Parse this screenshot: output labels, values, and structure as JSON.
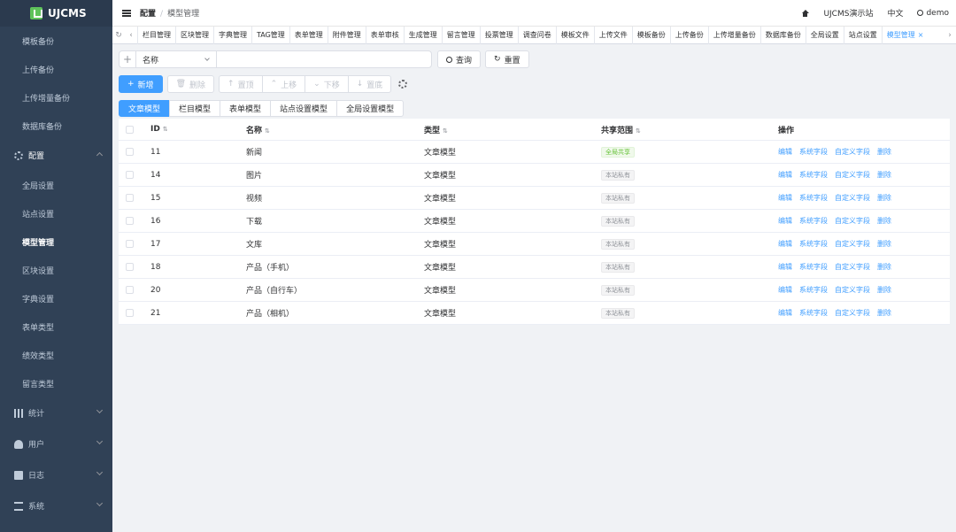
{
  "app": {
    "name": "UJCMS"
  },
  "sidebar": {
    "items_top": [
      {
        "label": "模板备份"
      },
      {
        "label": "上传备份"
      },
      {
        "label": "上传增量备份"
      },
      {
        "label": "数据库备份"
      }
    ],
    "config_group": {
      "label": "配置",
      "icon": "gear-icon"
    },
    "config_items": [
      {
        "label": "全局设置"
      },
      {
        "label": "站点设置"
      },
      {
        "label": "模型管理",
        "active": true
      },
      {
        "label": "区块设置"
      },
      {
        "label": "字典设置"
      },
      {
        "label": "表单类型"
      },
      {
        "label": "绩效类型"
      },
      {
        "label": "留言类型"
      }
    ],
    "groups": [
      {
        "label": "统计",
        "icon": "bar-chart-icon"
      },
      {
        "label": "用户",
        "icon": "user-icon"
      },
      {
        "label": "日志",
        "icon": "document-icon"
      },
      {
        "label": "系统",
        "icon": "sliders-icon"
      }
    ]
  },
  "header": {
    "breadcrumb_parent": "配置",
    "breadcrumb_sep": "/",
    "breadcrumb_current": "模型管理",
    "site": "UJCMS演示站",
    "lang": "中文",
    "user": "demo"
  },
  "tabs": [
    "栏目管理",
    "区块管理",
    "字典管理",
    "TAG管理",
    "表单管理",
    "附件管理",
    "表单审核",
    "生成管理",
    "留言管理",
    "投票管理",
    "调查问卷",
    "模板文件",
    "上传文件",
    "模板备份",
    "上传备份",
    "上传增量备份",
    "数据库备份",
    "全局设置",
    "站点设置",
    "模型管理"
  ],
  "search": {
    "field_select": "名称",
    "query_label": "查询",
    "reset_label": "重置"
  },
  "actions": {
    "add": "新增",
    "delete": "删除",
    "top": "置顶",
    "up": "上移",
    "down": "下移",
    "bottom": "置底"
  },
  "type_tabs": [
    "文章模型",
    "栏目模型",
    "表单模型",
    "站点设置模型",
    "全局设置模型"
  ],
  "table": {
    "headers": {
      "id": "ID",
      "name": "名称",
      "type": "类型",
      "scope": "共享范围",
      "ops": "操作"
    },
    "ops": [
      "编辑",
      "系统字段",
      "自定义字段",
      "删除"
    ],
    "rows": [
      {
        "id": "11",
        "name": "新闻",
        "type": "文章模型",
        "scope": "全局共享",
        "scope_color": "#67c23a"
      },
      {
        "id": "14",
        "name": "图片",
        "type": "文章模型",
        "scope": "本站私有",
        "scope_color": "#909399"
      },
      {
        "id": "15",
        "name": "视频",
        "type": "文章模型",
        "scope": "本站私有",
        "scope_color": "#909399"
      },
      {
        "id": "16",
        "name": "下载",
        "type": "文章模型",
        "scope": "本站私有",
        "scope_color": "#909399"
      },
      {
        "id": "17",
        "name": "文库",
        "type": "文章模型",
        "scope": "本站私有",
        "scope_color": "#909399"
      },
      {
        "id": "18",
        "name": "产品（手机）",
        "type": "文章模型",
        "scope": "本站私有",
        "scope_color": "#909399"
      },
      {
        "id": "20",
        "name": "产品（自行车）",
        "type": "文章模型",
        "scope": "本站私有",
        "scope_color": "#909399"
      },
      {
        "id": "21",
        "name": "产品（相机）",
        "type": "文章模型",
        "scope": "本站私有",
        "scope_color": "#909399"
      }
    ]
  },
  "colors": {
    "primary": "#409eff",
    "sidebar_bg": "#304156",
    "logo_green": "#5fc35b"
  }
}
